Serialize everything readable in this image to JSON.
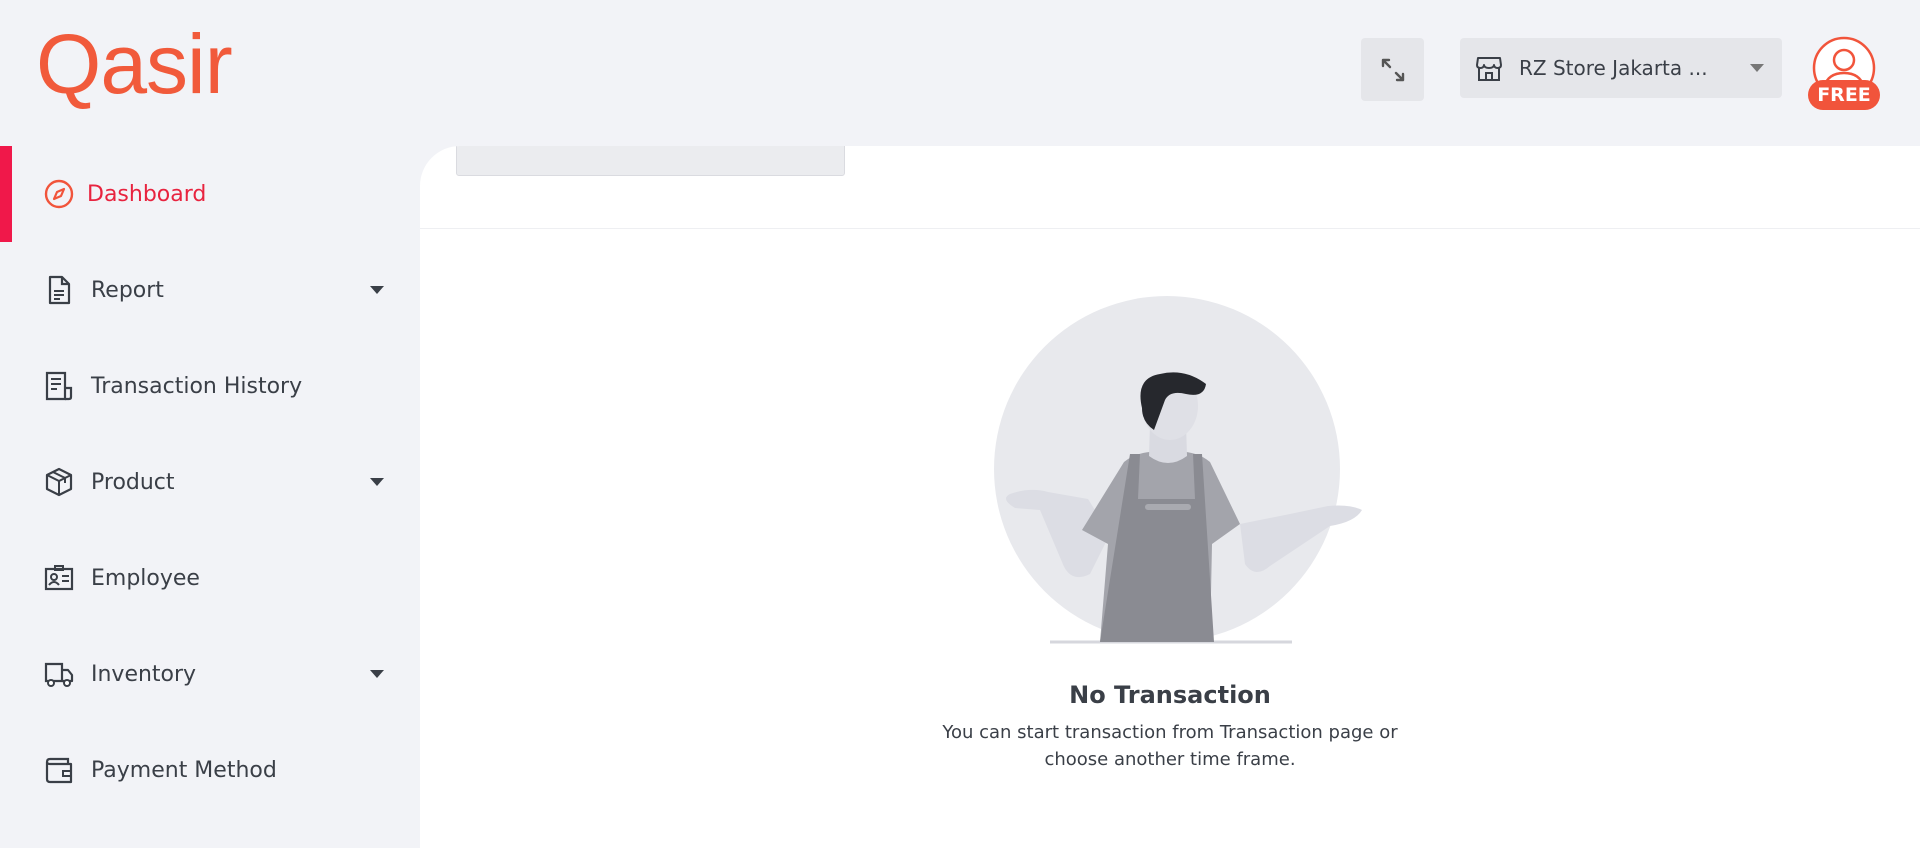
{
  "brand": {
    "logo_text": "Qasir",
    "color": "#f15a3b"
  },
  "header": {
    "expand_icon": "expand-arrows-icon",
    "store": {
      "label": "RZ Store Jakarta ...",
      "icon": "store-icon"
    },
    "account": {
      "badge": "FREE",
      "icon": "user-avatar-icon"
    }
  },
  "sidebar": {
    "accent_color": "#f0184a",
    "items": [
      {
        "label": "Dashboard",
        "icon": "compass-icon",
        "active": true,
        "has_submenu": false
      },
      {
        "label": "Report",
        "icon": "document-icon",
        "active": false,
        "has_submenu": true
      },
      {
        "label": "Transaction History",
        "icon": "receipt-icon",
        "active": false,
        "has_submenu": false
      },
      {
        "label": "Product",
        "icon": "box-icon",
        "active": false,
        "has_submenu": true
      },
      {
        "label": "Employee",
        "icon": "id-card-icon",
        "active": false,
        "has_submenu": false
      },
      {
        "label": "Inventory",
        "icon": "truck-icon",
        "active": false,
        "has_submenu": true
      },
      {
        "label": "Payment Method",
        "icon": "wallet-icon",
        "active": false,
        "has_submenu": false
      }
    ]
  },
  "main": {
    "empty_state": {
      "illustration": "shrugging-person-illustration",
      "title": "No Transaction",
      "description": "You can start transaction from Transaction page or choose another time frame."
    }
  }
}
